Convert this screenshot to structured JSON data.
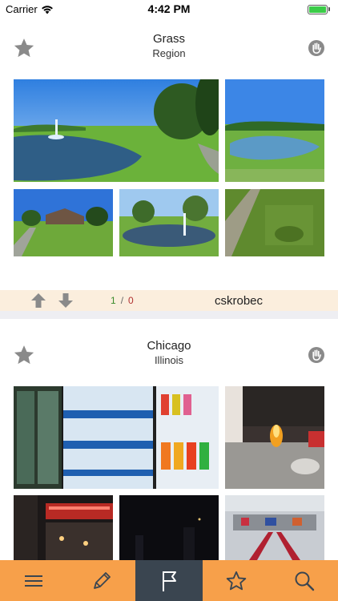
{
  "status": {
    "carrier": "Carrier",
    "time": "4:42 PM"
  },
  "posts": [
    {
      "title": "Grass",
      "subtitle": "Region"
    },
    {
      "title": "Chicago",
      "subtitle": "Illinois"
    }
  ],
  "vote": {
    "up_count": "1",
    "separator": "/",
    "down_count": "0",
    "username": "cskrobec"
  },
  "tabs": [
    {
      "icon": "menu-icon"
    },
    {
      "icon": "pencil-icon"
    },
    {
      "icon": "flag-icon",
      "active": true
    },
    {
      "icon": "star-icon"
    },
    {
      "icon": "search-icon"
    }
  ],
  "colors": {
    "tab_bar": "#f7a04a",
    "tab_active": "#3a4550",
    "vote_bar": "#fbeedd",
    "upvote": "#3a8a2a",
    "downvote": "#b03030"
  }
}
